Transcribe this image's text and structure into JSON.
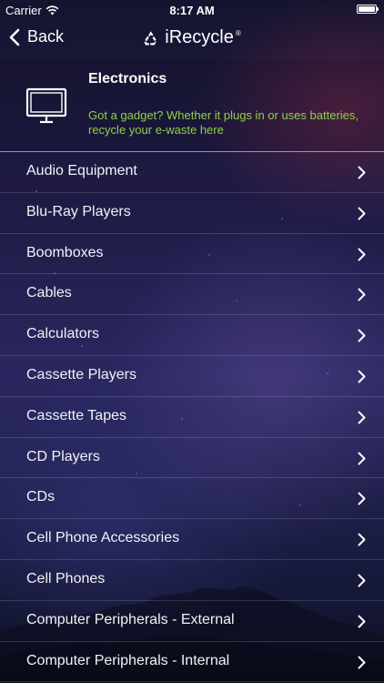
{
  "status_bar": {
    "carrier": "Carrier",
    "time": "8:17 AM"
  },
  "nav": {
    "back_label": "Back",
    "app_title": "iRecycle",
    "registered_mark": "®"
  },
  "category": {
    "title": "Electronics",
    "description": "Got a gadget? Whether it plugs in or uses batteries, recycle your e-waste here",
    "icon": "monitor-icon",
    "description_color": "#8fd04a"
  },
  "items": [
    {
      "label": "Audio Equipment"
    },
    {
      "label": "Blu-Ray Players"
    },
    {
      "label": "Boomboxes"
    },
    {
      "label": "Cables"
    },
    {
      "label": "Calculators"
    },
    {
      "label": "Cassette Players"
    },
    {
      "label": "Cassette Tapes"
    },
    {
      "label": "CD Players"
    },
    {
      "label": "CDs"
    },
    {
      "label": "Cell Phone Accessories"
    },
    {
      "label": "Cell Phones"
    },
    {
      "label": "Computer Peripherals - External"
    },
    {
      "label": "Computer Peripherals - Internal"
    }
  ]
}
